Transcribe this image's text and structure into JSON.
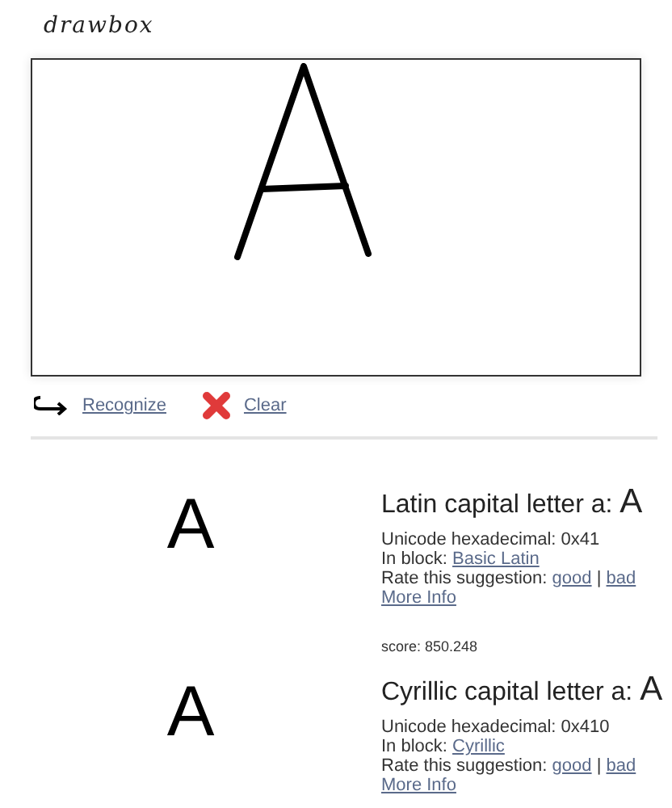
{
  "app": {
    "title": "drawbox"
  },
  "toolbar": {
    "recognize": "Recognize",
    "clear": "Clear"
  },
  "results": [
    {
      "glyph": "A",
      "name": "Latin capital letter a:",
      "name_glyph": "A",
      "hex_label": "Unicode hexadecimal: 0x41",
      "block_label": "In block:",
      "block": "Basic Latin",
      "rate_label": "Rate this suggestion:",
      "good": "good",
      "separator": "|",
      "bad": "bad",
      "more": "More Info",
      "score": "score: 850.248"
    },
    {
      "glyph": "A",
      "name": "Cyrillic capital letter a:",
      "name_glyph": "A",
      "hex_label": "Unicode hexadecimal: 0x410",
      "block_label": "In block:",
      "block": "Cyrillic",
      "rate_label": "Rate this suggestion:",
      "good": "good",
      "separator": "|",
      "bad": "bad",
      "more": "More Info"
    }
  ]
}
